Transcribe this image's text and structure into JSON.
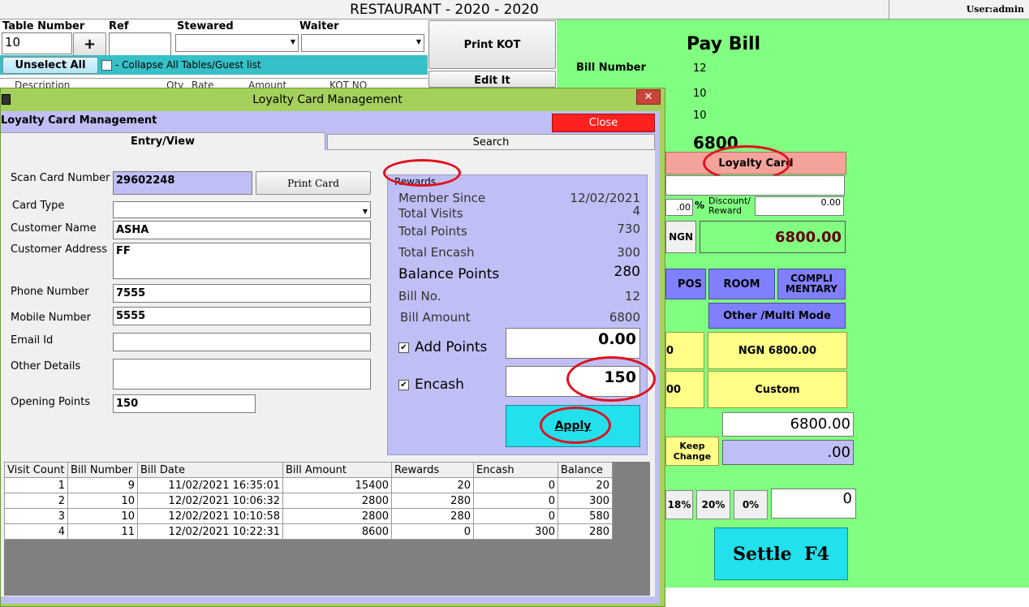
{
  "window": {
    "title": "RESTAURANT - 2020 - 2020",
    "user": "User:admin"
  },
  "order": {
    "table_number_label": "Table Number",
    "table_number_value": "10",
    "plus_label": "+",
    "ref_label": "Ref",
    "stewarded_label": "Stewared",
    "waiter_label": "Waiter",
    "print_kot_label": "Print KOT",
    "edit_partial": "Edit It",
    "unselect_all_label": "Unselect All",
    "collapse_label": "- Collapse All Tables/Guest list",
    "columns": [
      "Description",
      "Qty",
      "Rate",
      "Amount",
      "KOT NO"
    ]
  },
  "pay_bill": {
    "title": "Pay Bill",
    "bill_number_label": "Bill Number",
    "bill_number_value": "12",
    "value_2": "10",
    "value_3": "10",
    "total": "6800",
    "loyalty_card_label": "Loyalty Card",
    "pct_value": ".00",
    "pct_sign": "%",
    "discount_label": "Discount/\nReward",
    "discount_value": "0.00",
    "currency_label": "NGN",
    "amount_due": "6800.00",
    "pos_label": "POS",
    "room_label": "ROOM",
    "compli_label": "COMPLI\nMENTARY",
    "other_multi_label": "Other /Multi Mode",
    "yellow1_partial": "0",
    "ngn_amount_label": "NGN 6800.00",
    "yellow2_partial": "00",
    "custom_label": "Custom",
    "tendered_value": "6800.00",
    "keep_change_label": "Keep\nChange",
    "change_value": ".00",
    "pct_buttons": [
      "18%",
      "20%",
      "0%"
    ],
    "tip_value": "0",
    "settle_label": "Settle  F4"
  },
  "dialog": {
    "title": "Loyalty Card Management",
    "close_x": "✕",
    "header": "Loyalty Card Management",
    "close_label": "Close",
    "tab_entry": "Entry/View",
    "tab_search": "Search",
    "form": {
      "scan_card_label": "Scan Card Number",
      "scan_card_value": "29602248",
      "print_card_label": "Print Card",
      "card_type_label": "Card Type",
      "card_type_value": "",
      "customer_name_label": "Customer  Name",
      "customer_name_value": "ASHA",
      "customer_address_label": "Customer Address",
      "customer_address_value": "FF",
      "phone_label": "Phone Number",
      "phone_value": "7555",
      "mobile_label": "Mobile  Number",
      "mobile_value": "5555",
      "email_label": "Email Id",
      "email_value": "",
      "other_details_label": "Other Details",
      "other_details_value": "",
      "opening_points_label": "Opening Points",
      "opening_points_value": "150"
    },
    "rewards": {
      "legend": "Rewards",
      "member_since_label": "Member Since",
      "member_since_value": "12/02/2021",
      "total_visits_label": "Total Visits",
      "total_visits_value": "4",
      "total_points_label": "Total Points",
      "total_points_value": "730",
      "total_encash_label": "Total Encash",
      "total_encash_value": "300",
      "balance_points_label": "Balance Points",
      "balance_points_value": "280",
      "bill_no_label": "Bill No.",
      "bill_no_value": "12",
      "bill_amount_label": "Bill Amount",
      "bill_amount_value": "6800",
      "add_points_label": "Add Points",
      "add_points_value": "0.00",
      "encash_label": "Encash",
      "encash_value": "150",
      "apply_label": "Apply",
      "check_mark": "✔"
    },
    "grid": {
      "columns": [
        "Visit Count",
        "Bill Number",
        "Bill Date",
        "Bill Amount",
        "Rewards",
        "Encash",
        "Balance"
      ],
      "rows": [
        [
          "1",
          "9",
          "11/02/2021 16:35:01",
          "15400",
          "20",
          "0",
          "20"
        ],
        [
          "2",
          "10",
          "12/02/2021 10:06:32",
          "2800",
          "280",
          "0",
          "300"
        ],
        [
          "3",
          "10",
          "12/02/2021 10:10:58",
          "2800",
          "280",
          "0",
          "580"
        ],
        [
          "4",
          "11",
          "12/02/2021 10:22:31",
          "8600",
          "0",
          "300",
          "280"
        ]
      ]
    }
  },
  "colors": {
    "green_panel": "#80ff80",
    "dialog_purple": "#bfbff5",
    "apply_cyan": "#22e0ec",
    "close_red": "#ff2020",
    "highlight_ring": "#e0101e"
  }
}
